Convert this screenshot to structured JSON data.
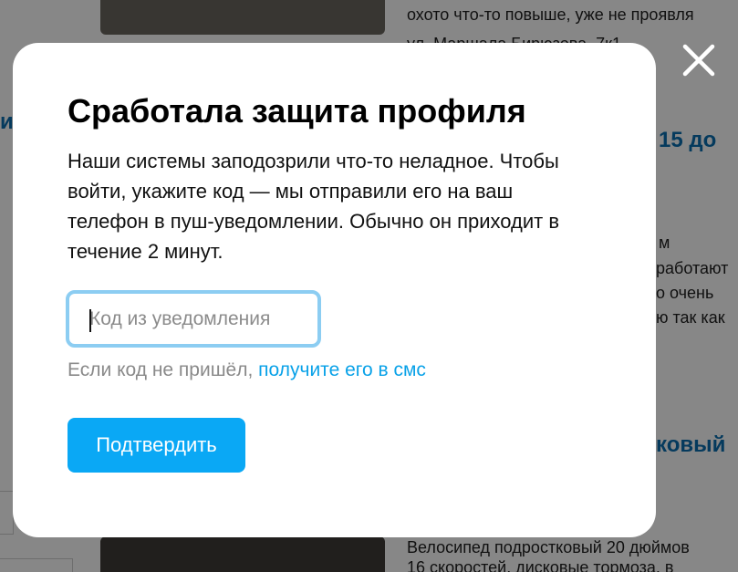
{
  "background": {
    "line1": "охото что-то повыше, уже не проявля",
    "line2": "ул. Маршала Бирюзова, 7к1",
    "price_fragment": "15 до",
    "snippet1": "м",
    "snippet2": "работают",
    "snippet3": "о очень",
    "snippet4": "ю так как",
    "title_fragment": "ковый",
    "bottom_line1": "Велосипед подростковый 20 дюймов",
    "bottom_line2": "16 скоростей, дисковые тормоза, в",
    "left_fragment": "и"
  },
  "modal": {
    "title": "Сработала защита профиля",
    "description": "Наши системы заподозрили что-то неладное. Чтобы войти, укажите код — мы отправили его на ваш телефон в пуш-уведомлении. Обычно он приходит в течение 2 минут.",
    "code_input": {
      "value": "",
      "placeholder": "Код из уведомления"
    },
    "hint_text": "Если код не пришёл,",
    "hint_link": "получите его в смс",
    "confirm_label": "Подтвердить"
  },
  "colors": {
    "accent": "#0aa8f5",
    "link": "#0aa2e8",
    "input_border": "#8ccdf2",
    "overlay": "rgba(0,0,0,0.47)"
  },
  "icons": {
    "close": "close-icon"
  }
}
